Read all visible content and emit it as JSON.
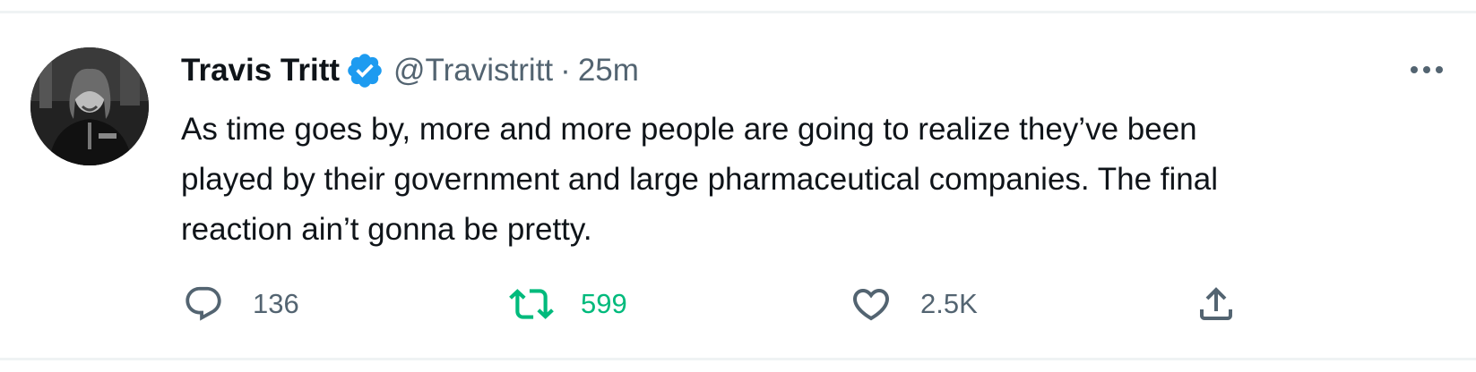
{
  "tweet": {
    "author_name": "Travis Tritt",
    "handle": "@Travistritt",
    "separator": "·",
    "time": "25m",
    "text_lines": [
      "As time goes by, more and more people are going to realize they’ve been",
      "played by their government and large pharmaceutical companies. The final",
      "reaction ain’t gonna be pretty."
    ],
    "verified": true
  },
  "actions": {
    "replies": "136",
    "retweets": "599",
    "likes": "2.5K"
  },
  "colors": {
    "text": "#0f1419",
    "muted": "#536471",
    "verified_blue": "#1d9bf0",
    "retweet_green": "#00ba7c"
  },
  "icons": {
    "reply": "reply-bubble-icon",
    "retweet": "retweet-icon",
    "like": "heart-icon",
    "share": "share-icon",
    "more": "more-dots-icon",
    "verified": "verified-badge-icon"
  }
}
